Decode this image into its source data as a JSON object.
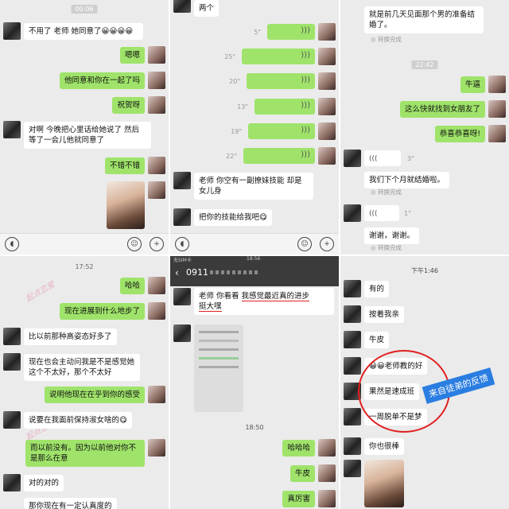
{
  "p1": {
    "time": "00:06",
    "m1": "不用了 老师 她同意了😀😀😀😀",
    "m2": "嗯嗯",
    "m3": "他同意和你在一起了吗",
    "m4": "祝贺呀",
    "m5": "对啊 今晚把心里话给她说了 然后等了一会儿他就同意了",
    "m6": "不错不错"
  },
  "p2": {
    "m0": "两个",
    "d1": "5\"",
    "d2": "25\"",
    "d3": "20\"",
    "d4": "13\"",
    "d5": "19\"",
    "d6": "22\"",
    "m7": "老师 你空有一副撩妹技能 却是女儿身",
    "m8": "把你的技能给我吧😋"
  },
  "p3": {
    "m1": "就是前几天见面那个男的准备结婚了。",
    "conv": "转换完成",
    "time": "22:42",
    "m2": "牛逼",
    "m3": "这么快就找到女朋友了",
    "m4": "恭喜恭喜呀!",
    "d1": "3\"",
    "m5": "我们下个月就结婚啦。",
    "d2": "1\"",
    "m6": "谢谢，谢谢。"
  },
  "p4": {
    "time": "17:52",
    "m1": "哈哈",
    "m2": "现在进展到什么地步了",
    "m3": "比以前那种高姿态好多了",
    "m4": "现在也会主动问我是不是感觉她这个不太好，那个不太好",
    "m5": "说明他现在在乎到你的感受",
    "m6": "说要在我面前保持淑女啥的😋",
    "m7": "而以前没有。因为以前他对你不是那么在意",
    "m8": "对的对的",
    "m9": "那你现在有一定认真度的",
    "wm": "起点恋爱"
  },
  "p5": {
    "status": "无SIM卡",
    "clock": "18:56",
    "title": "0911",
    "m1a": "老师 你看看 ",
    "m1b": "我感觉最近真的进步",
    "m1c": "挺大嘿",
    "time": "18:50",
    "m2": "哈哈哈",
    "m3": "牛皮",
    "m4": "真厉害"
  },
  "p6": {
    "time": "下午1:46",
    "m1": "有的",
    "m2": "按着我亲",
    "m3": "牛皮",
    "m4": "😀😀老师教的好",
    "m5": "果然是速成班",
    "m6": "一周脱单不是梦",
    "m7": "你也很棒",
    "label": "来自徒弟的反馈"
  }
}
